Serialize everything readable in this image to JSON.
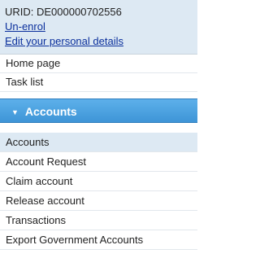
{
  "user": {
    "urid_text": "URID: DE000000702556",
    "unenrol_link": "Un-enrol",
    "edit_details_link": "Edit your personal details"
  },
  "nav": {
    "items": [
      {
        "label": "Home page"
      },
      {
        "label": "Task list"
      }
    ]
  },
  "accounts_section": {
    "header_label": "Accounts",
    "caret_icon": "triangle-down-icon",
    "items": [
      {
        "label": "Accounts",
        "active": true
      },
      {
        "label": "Account Request"
      },
      {
        "label": "Claim account"
      },
      {
        "label": "Release account"
      },
      {
        "label": "Transactions"
      },
      {
        "label": "Export Government Accounts"
      }
    ]
  },
  "colors": {
    "header_bg": "#4aa3e2",
    "user_box_bg": "#dde9f3",
    "link": "#0a2f9c"
  }
}
